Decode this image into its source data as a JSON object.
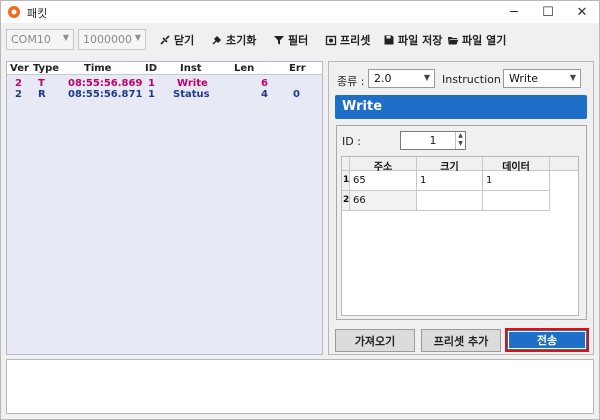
{
  "window": {
    "title": "패킷",
    "minimize": "─",
    "maximize": "☐",
    "close": "✕"
  },
  "toolbar": {
    "port": "COM10",
    "baud": "1000000",
    "close_label": "닫기",
    "reset_label": "초기화",
    "filter_label": "필터",
    "preset_label": "프리셋",
    "save_label": "파일 저장",
    "open_label": "파일 열기"
  },
  "packet_list": {
    "headers": [
      "Ver",
      "Type",
      "Time",
      "ID",
      "Inst",
      "Len",
      "Err"
    ],
    "rows": [
      {
        "ver": "2",
        "type": "T",
        "time": "08:55:56.869",
        "id": "1",
        "inst": "Write",
        "len": "6",
        "err": "",
        "color": "#c0006a"
      },
      {
        "ver": "2",
        "type": "R",
        "time": "08:55:56.871",
        "id": "1",
        "inst": "Status",
        "len": "4",
        "err": "0",
        "color": "#1f3a8a"
      }
    ]
  },
  "editor": {
    "kind_label": "종류 :",
    "kind_value": "2.0",
    "instruction_label": "Instruction :",
    "instruction_value": "Write",
    "banner": "Write",
    "id_label": "ID :",
    "id_value": "1",
    "columns": [
      "주소",
      "크기",
      "데이터"
    ],
    "rows": [
      {
        "index": "1",
        "address": "65",
        "size": "1",
        "data": "1"
      },
      {
        "index": "2",
        "address": "66",
        "size": "",
        "data": ""
      }
    ]
  },
  "actions": {
    "fetch_label": "가져오기",
    "add_preset_label": "프리셋 추가",
    "send_label": "전송"
  },
  "colors": {
    "accent": "#1f6ec7",
    "highlight": "#e01010",
    "tx_row": "#c0006a",
    "rx_row": "#1f3a8a"
  }
}
